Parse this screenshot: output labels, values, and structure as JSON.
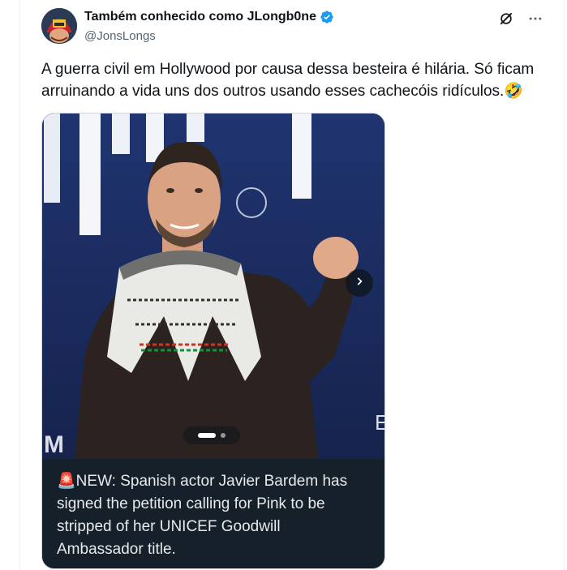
{
  "author": {
    "display_name": "Também conhecido como JLongb0ne",
    "handle": "@JonsLongs",
    "verified": true
  },
  "icons": {
    "verified": "verified-badge-icon",
    "grok": "grok-icon",
    "more": "more-options-icon",
    "next": "chevron-right-icon",
    "emoji": "rolling-laughing-emoji",
    "siren": "siren-emoji"
  },
  "tweet": {
    "text": "A guerra civil em Hollywood por causa dessa besteira é hilária. Só ficam arruinando a vida uns dos outros usando esses cachecóis ridículos.",
    "emoji": "🤣"
  },
  "media": {
    "caption_prefix": "🚨",
    "caption": "NEW: Spanish actor Javier Bardem has signed the petition calling for Pink to be stripped of her UNICEF Goodwill Ambassador title.",
    "slide_current": 1,
    "slide_total": 2
  },
  "colors": {
    "text": "#0f1419",
    "muted": "#536471",
    "verified": "#1d9bf0",
    "caption_bg": "#15202b",
    "photo_backdrop": "#1f3163"
  }
}
